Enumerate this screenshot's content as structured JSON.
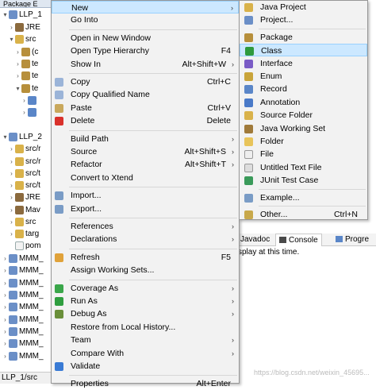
{
  "explorer": {
    "tab_label": "Package E",
    "rows": [
      {
        "label": "LLP_1",
        "arrow": "▾",
        "indent": 0,
        "icon": "project-icon"
      },
      {
        "label": "JRE",
        "arrow": "›",
        "indent": 1,
        "icon": "library-icon"
      },
      {
        "label": "src",
        "arrow": "▾",
        "indent": 1,
        "icon": "source-folder-icon"
      },
      {
        "label": "(c",
        "arrow": "›",
        "indent": 2,
        "icon": "package-icon"
      },
      {
        "label": "te",
        "arrow": "›",
        "indent": 2,
        "icon": "package-icon"
      },
      {
        "label": "te",
        "arrow": "›",
        "indent": 2,
        "icon": "package-icon"
      },
      {
        "label": "te",
        "arrow": "▾",
        "indent": 2,
        "icon": "package-icon"
      },
      {
        "label": "",
        "arrow": "›",
        "indent": 3,
        "icon": "java-file-icon"
      },
      {
        "label": "",
        "arrow": "›",
        "indent": 3,
        "icon": "java-file-icon"
      },
      {
        "label": "",
        "arrow": "",
        "indent": 0,
        "icon": ""
      },
      {
        "label": "LLP_2",
        "arrow": "▾",
        "indent": 0,
        "icon": "project-icon"
      },
      {
        "label": "src/r",
        "arrow": "›",
        "indent": 1,
        "icon": "source-folder-icon"
      },
      {
        "label": "src/r",
        "arrow": "›",
        "indent": 1,
        "icon": "source-folder-icon"
      },
      {
        "label": "src/t",
        "arrow": "›",
        "indent": 1,
        "icon": "source-folder-icon"
      },
      {
        "label": "src/t",
        "arrow": "›",
        "indent": 1,
        "icon": "source-folder-icon"
      },
      {
        "label": "JRE",
        "arrow": "›",
        "indent": 1,
        "icon": "library-icon"
      },
      {
        "label": "Mav",
        "arrow": "›",
        "indent": 1,
        "icon": "library-icon"
      },
      {
        "label": "src",
        "arrow": "›",
        "indent": 1,
        "icon": "folder-icon"
      },
      {
        "label": "targ",
        "arrow": "›",
        "indent": 1,
        "icon": "folder-icon"
      },
      {
        "label": "pom",
        "arrow": "",
        "indent": 1,
        "icon": "file-icon"
      },
      {
        "label": "MMM_",
        "arrow": "›",
        "indent": 0,
        "icon": "project-icon"
      },
      {
        "label": "MMM_",
        "arrow": "›",
        "indent": 0,
        "icon": "project-icon"
      },
      {
        "label": "MMM_",
        "arrow": "›",
        "indent": 0,
        "icon": "project-icon"
      },
      {
        "label": "MMM_",
        "arrow": "›",
        "indent": 0,
        "icon": "project-icon"
      },
      {
        "label": "MMM_",
        "arrow": "›",
        "indent": 0,
        "icon": "project-icon"
      },
      {
        "label": "MMM_",
        "arrow": "›",
        "indent": 0,
        "icon": "project-icon"
      },
      {
        "label": "MMM_",
        "arrow": "›",
        "indent": 0,
        "icon": "project-icon"
      },
      {
        "label": "MMM_",
        "arrow": "›",
        "indent": 0,
        "icon": "project-icon"
      },
      {
        "label": "MMM_",
        "arrow": "›",
        "indent": 0,
        "icon": "project-icon"
      }
    ],
    "status": "LLP_1/src"
  },
  "bottom_panel": {
    "tab_javadoc": "Javadoc",
    "tab_console": "Console",
    "tab_progress": "Progre",
    "console_text": "splay at this time."
  },
  "watermark": "https://blog.csdn.net/weixin_45695...",
  "context_menu": {
    "items": [
      {
        "label": "New",
        "shortcut": "",
        "submenu": true,
        "icon": "",
        "highlight": true
      },
      {
        "label": "Go Into",
        "shortcut": "",
        "submenu": false,
        "icon": ""
      },
      {
        "sep": true
      },
      {
        "label": "Open in New Window",
        "shortcut": "",
        "submenu": false,
        "icon": ""
      },
      {
        "label": "Open Type Hierarchy",
        "shortcut": "F4",
        "submenu": false,
        "icon": ""
      },
      {
        "label": "Show In",
        "shortcut": "Alt+Shift+W",
        "submenu": true,
        "icon": ""
      },
      {
        "sep": true
      },
      {
        "label": "Copy",
        "shortcut": "Ctrl+C",
        "submenu": false,
        "icon": "copy-icon"
      },
      {
        "label": "Copy Qualified Name",
        "shortcut": "",
        "submenu": false,
        "icon": "copy-qualified-icon"
      },
      {
        "label": "Paste",
        "shortcut": "Ctrl+V",
        "submenu": false,
        "icon": "paste-icon"
      },
      {
        "label": "Delete",
        "shortcut": "Delete",
        "submenu": false,
        "icon": "delete-icon"
      },
      {
        "sep": true
      },
      {
        "label": "Build Path",
        "shortcut": "",
        "submenu": true,
        "icon": ""
      },
      {
        "label": "Source",
        "shortcut": "Alt+Shift+S",
        "submenu": true,
        "icon": ""
      },
      {
        "label": "Refactor",
        "shortcut": "Alt+Shift+T",
        "submenu": true,
        "icon": ""
      },
      {
        "label": "Convert to Xtend",
        "shortcut": "",
        "submenu": false,
        "icon": ""
      },
      {
        "sep": true
      },
      {
        "label": "Import...",
        "shortcut": "",
        "submenu": false,
        "icon": "import-icon"
      },
      {
        "label": "Export...",
        "shortcut": "",
        "submenu": false,
        "icon": "export-icon"
      },
      {
        "sep": true
      },
      {
        "label": "References",
        "shortcut": "",
        "submenu": true,
        "icon": ""
      },
      {
        "label": "Declarations",
        "shortcut": "",
        "submenu": true,
        "icon": ""
      },
      {
        "sep": true
      },
      {
        "label": "Refresh",
        "shortcut": "F5",
        "submenu": false,
        "icon": "refresh-icon"
      },
      {
        "label": "Assign Working Sets...",
        "shortcut": "",
        "submenu": false,
        "icon": ""
      },
      {
        "sep": true
      },
      {
        "label": "Coverage As",
        "shortcut": "",
        "submenu": true,
        "icon": "coverage-icon"
      },
      {
        "label": "Run As",
        "shortcut": "",
        "submenu": true,
        "icon": "run-icon"
      },
      {
        "label": "Debug As",
        "shortcut": "",
        "submenu": true,
        "icon": "debug-icon"
      },
      {
        "label": "Restore from Local History...",
        "shortcut": "",
        "submenu": false,
        "icon": ""
      },
      {
        "label": "Team",
        "shortcut": "",
        "submenu": true,
        "icon": ""
      },
      {
        "label": "Compare With",
        "shortcut": "",
        "submenu": true,
        "icon": ""
      },
      {
        "label": "Validate",
        "shortcut": "",
        "submenu": false,
        "icon": "check-icon"
      },
      {
        "sep": true
      },
      {
        "label": "Properties",
        "shortcut": "Alt+Enter",
        "submenu": false,
        "icon": ""
      }
    ]
  },
  "submenu": {
    "items": [
      {
        "label": "Java Project",
        "shortcut": "",
        "icon": "java-project-icon"
      },
      {
        "label": "Project...",
        "shortcut": "",
        "icon": "project-icon"
      },
      {
        "sep": true
      },
      {
        "label": "Package",
        "shortcut": "",
        "icon": "package-icon"
      },
      {
        "label": "Class",
        "shortcut": "",
        "icon": "class-icon",
        "highlight": true
      },
      {
        "label": "Interface",
        "shortcut": "",
        "icon": "interface-icon"
      },
      {
        "label": "Enum",
        "shortcut": "",
        "icon": "enum-icon"
      },
      {
        "label": "Record",
        "shortcut": "",
        "icon": "record-icon"
      },
      {
        "label": "Annotation",
        "shortcut": "",
        "icon": "annotation-icon"
      },
      {
        "label": "Source Folder",
        "shortcut": "",
        "icon": "source-folder-icon"
      },
      {
        "label": "Java Working Set",
        "shortcut": "",
        "icon": "working-set-icon"
      },
      {
        "label": "Folder",
        "shortcut": "",
        "icon": "folder-icon"
      },
      {
        "label": "File",
        "shortcut": "",
        "icon": "file-icon"
      },
      {
        "label": "Untitled Text File",
        "shortcut": "",
        "icon": "text-file-icon"
      },
      {
        "label": "JUnit Test Case",
        "shortcut": "",
        "icon": "junit-icon"
      },
      {
        "sep": true
      },
      {
        "label": "Example...",
        "shortcut": "",
        "icon": "example-icon"
      },
      {
        "sep": true
      },
      {
        "label": "Other...",
        "shortcut": "Ctrl+N",
        "icon": "other-icon"
      }
    ]
  },
  "icon_colors": {
    "copy-icon": "#9bb4d8",
    "copy-qualified-icon": "#9bb4d8",
    "paste-icon": "#c9a85c",
    "delete-icon": "#d9312b",
    "import-icon": "#7a9cc6",
    "export-icon": "#7a9cc6",
    "refresh-icon": "#e0a23a",
    "coverage-icon": "#3aa64a",
    "run-icon": "#2f9e3f",
    "debug-icon": "#6a8f3a",
    "check-icon": "#3a7bd5",
    "java-project-icon": "#d9b24a",
    "project-icon": "#6b8fc7",
    "package-icon": "#b78f3b",
    "class-icon": "#2e9a3e",
    "interface-icon": "#7a5cc6",
    "enum-icon": "#c9a43a",
    "record-icon": "#5a86c8",
    "annotation-icon": "#4a7ac8",
    "source-folder-icon": "#d9b24a",
    "working-set-icon": "#a07a3a",
    "folder-icon": "#e8c45a",
    "file-icon": "#eeeeee",
    "text-file-icon": "#dddddd",
    "junit-icon": "#3a9a5a",
    "example-icon": "#7a9cc6",
    "other-icon": "#c8a84a"
  }
}
